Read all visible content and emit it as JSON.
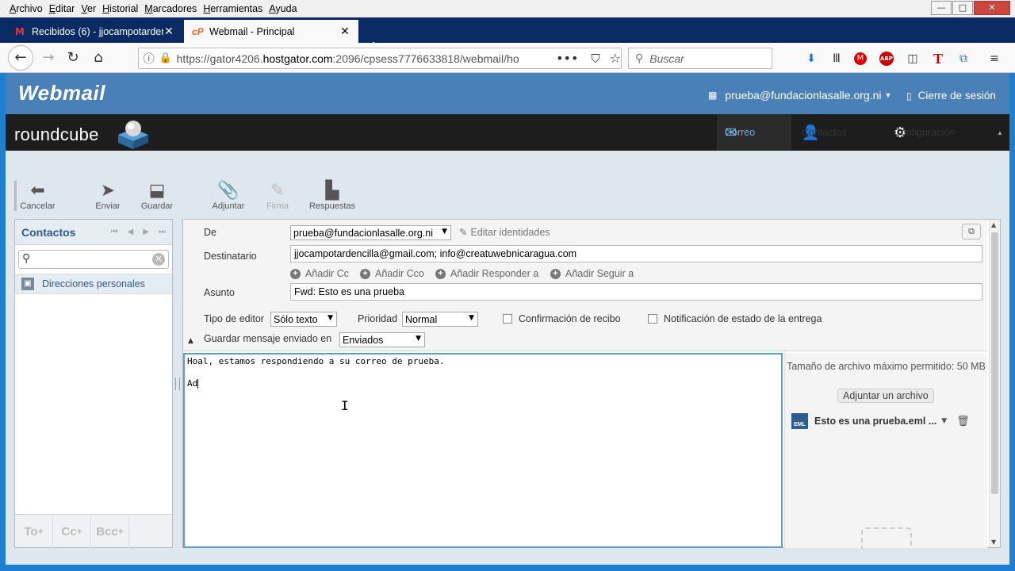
{
  "browser": {
    "menu": [
      "Archivo",
      "Editar",
      "Ver",
      "Historial",
      "Marcadores",
      "Herramientas",
      "Ayuda"
    ],
    "window_controls": {
      "minimize": "—",
      "maximize": "□",
      "close": "✕"
    },
    "tabs": [
      {
        "title": "Recibidos (6) - jjocampotarden",
        "close": "✕",
        "favicon": "M"
      },
      {
        "title": "Webmail - Principal",
        "close": "✕",
        "favicon": "cP"
      }
    ],
    "new_tab": "+",
    "url_prefix": "https://gator4206.",
    "url_domain": "hostgator.com",
    "url_rest": ":2096/cpsess7776633818/webmail/ho",
    "search_placeholder": "Buscar"
  },
  "cpanel": {
    "logo": "Webmail",
    "user": "prueba@fundacionlasalle.org.ni",
    "logout": "Cierre de sesión"
  },
  "roundcube": {
    "logo": "roundcube",
    "nav": {
      "mail": "Correo",
      "contacts": "Contactos",
      "settings": "Configuración"
    }
  },
  "toolbar": {
    "cancel": "Cancelar",
    "send": "Enviar",
    "save": "Guardar",
    "attach": "Adjuntar",
    "signature": "Firma",
    "responses": "Respuestas"
  },
  "contacts": {
    "title": "Contactos",
    "nav": [
      "⏮",
      "◀",
      "▶",
      "⏭"
    ],
    "item": "Direcciones personales",
    "footer": [
      {
        "label": "To",
        "sup": "+"
      },
      {
        "label": "Cc",
        "sup": "+"
      },
      {
        "label": "Bcc",
        "sup": "+"
      }
    ]
  },
  "compose": {
    "from_label": "De",
    "from_value": "prueba@fundacionlasalle.org.ni",
    "edit_identities": "Editar identidades",
    "to_label": "Destinatario",
    "to_value": "jjocampotardencilla@gmail.com; info@creatuwebnicaragua.com",
    "add_cc": "Añadir Cc",
    "add_bcc": "Añadir Cco",
    "add_reply_to": "Añadir Responder a",
    "add_followup": "Añadir Seguir a",
    "subject_label": "Asunto",
    "subject_value": "Fwd: Esto es una prueba",
    "editor_type_label": "Tipo de editor",
    "editor_type_value": "Sólo texto",
    "priority_label": "Prioridad",
    "priority_value": "Normal",
    "receipt_label": "Confirmación de recibo",
    "dsn_label": "Notificación de estado de la entrega",
    "save_in_label": "Guardar mensaje enviado en",
    "save_in_value": "Enviados",
    "body_line1": "Hoal, estamos respondiendo a su correo de prueba.",
    "body_line2": "Ad"
  },
  "attachments": {
    "max_size": "Tamaño de archivo máximo permitido: 50 MB",
    "attach_button": "Adjuntar un archivo",
    "file_name": "Esto es una prueba.eml ...",
    "file_type": "EML"
  }
}
